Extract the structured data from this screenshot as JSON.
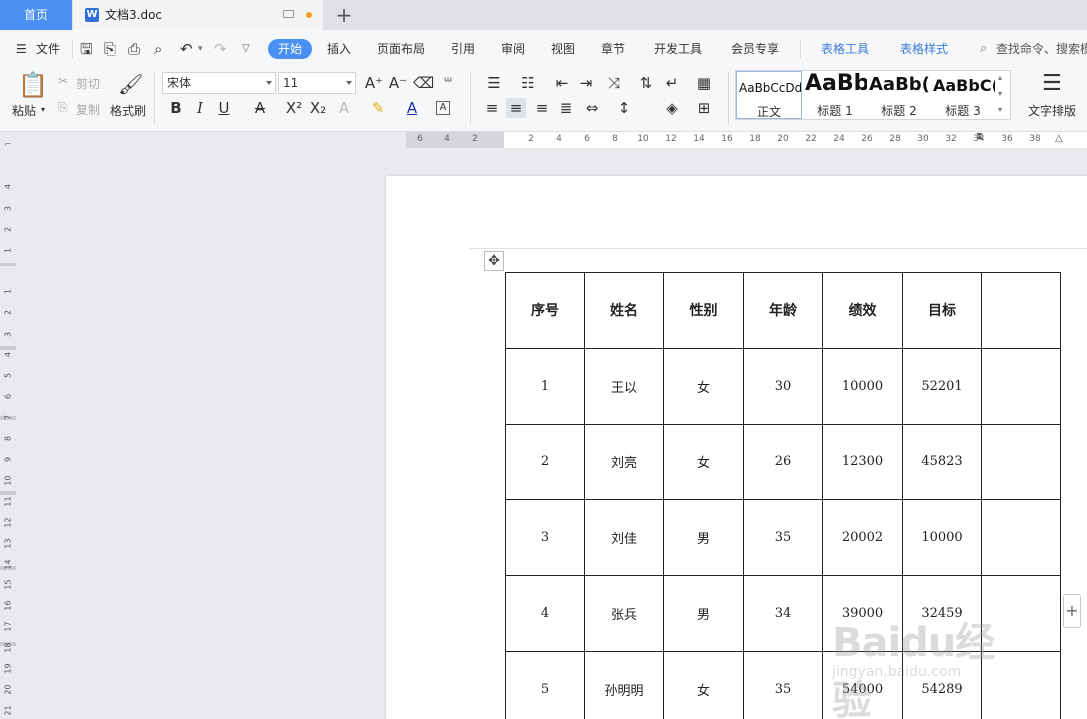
{
  "tabs": {
    "home": "首页",
    "doc_title": "文档3.doc",
    "add": "+"
  },
  "menu": {
    "file": "文件",
    "items": [
      "开始",
      "插入",
      "页面布局",
      "引用",
      "审阅",
      "视图",
      "章节",
      "开发工具",
      "会员专享"
    ],
    "table_tools": "表格工具",
    "table_style": "表格样式",
    "search": "查找命令、搜索模"
  },
  "ribbon": {
    "paste": "粘贴",
    "cut": "剪切",
    "copy": "复制",
    "format_painter": "格式刷",
    "font_name": "宋体",
    "font_size": "11",
    "text_layout": "文字排版",
    "styles": [
      {
        "preview": "AaBbCcDd",
        "label": "正文"
      },
      {
        "preview": "AaBb",
        "label": "标题 1"
      },
      {
        "preview": "AaBb(",
        "label": "标题 2"
      },
      {
        "preview": "AaBbC(",
        "label": "标题 3"
      }
    ]
  },
  "ruler": {
    "h_ticks": [
      "6",
      "4",
      "2",
      "2",
      "4",
      "6",
      "8",
      "10",
      "12",
      "14",
      "16",
      "18",
      "20",
      "22",
      "24",
      "26",
      "28",
      "30",
      "32",
      "34",
      "36",
      "38"
    ],
    "v_ticks": [
      "4",
      "3",
      "2",
      "1",
      "1",
      "2",
      "3",
      "4",
      "5",
      "6",
      "7",
      "8",
      "9",
      "10",
      "11",
      "12",
      "13",
      "14",
      "15",
      "16",
      "17",
      "18",
      "19",
      "20",
      "21"
    ]
  },
  "table": {
    "headers": [
      "序号",
      "姓名",
      "性别",
      "年龄",
      "绩效",
      "目标",
      ""
    ],
    "rows": [
      [
        "1",
        "王以",
        "女",
        "30",
        "10000",
        "52201",
        ""
      ],
      [
        "2",
        "刘亮",
        "女",
        "26",
        "12300",
        "45823",
        ""
      ],
      [
        "3",
        "刘佳",
        "男",
        "35",
        "20002",
        "10000",
        ""
      ],
      [
        "4",
        "张兵",
        "男",
        "34",
        "39000",
        "32459",
        ""
      ],
      [
        "5",
        "孙明明",
        "女",
        "35",
        "54000",
        "54289",
        ""
      ]
    ]
  },
  "watermark": {
    "brand": "Baidu经验",
    "url": "jingyan.baidu.com"
  },
  "colors": {
    "accent": "#4a8ff2",
    "table_tools": "#3b7cd6"
  }
}
